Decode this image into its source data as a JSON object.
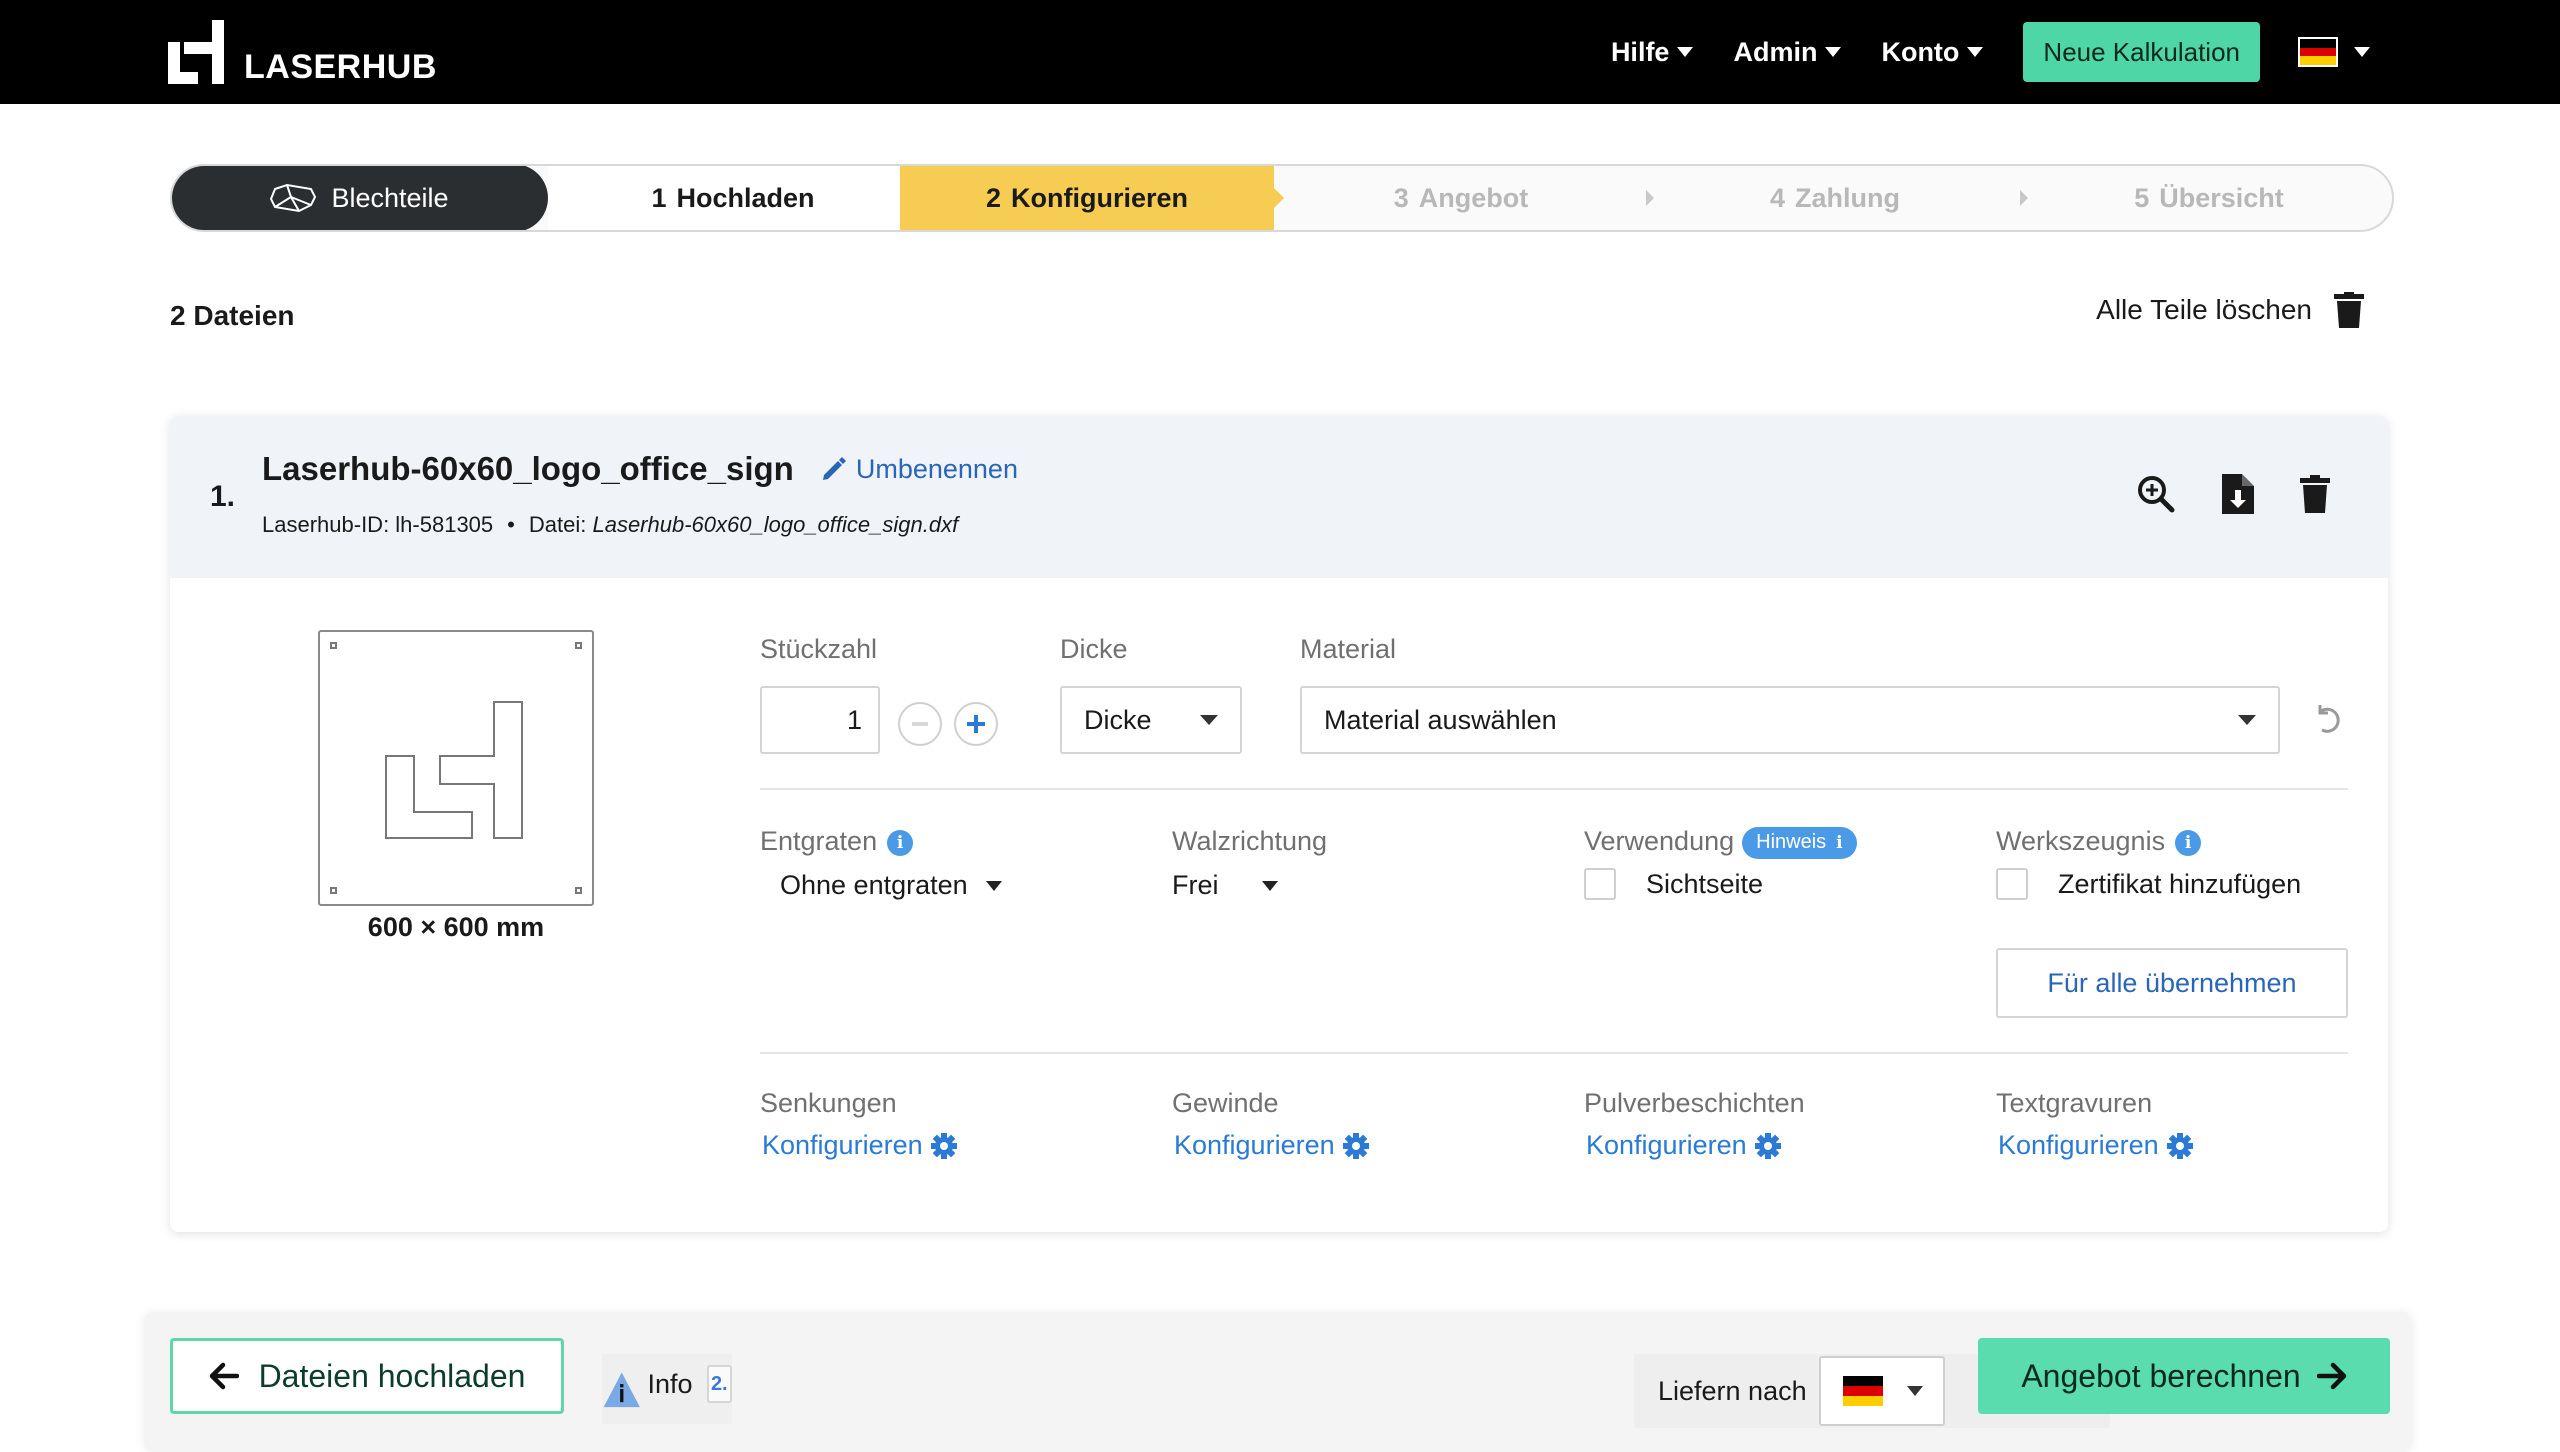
{
  "navbar": {
    "brand": "LASERHUB",
    "menu": [
      {
        "label": "Hilfe"
      },
      {
        "label": "Admin"
      },
      {
        "label": "Konto"
      }
    ],
    "new_calc_label": "Neue Kalkulation",
    "language_flag": "de-flag",
    "colors": {
      "background": "#000000",
      "accent": "#4fd6a6"
    }
  },
  "stepper": {
    "category_label": "Blechteile",
    "steps": [
      {
        "num": "1",
        "label": "Hochladen",
        "state": "done"
      },
      {
        "num": "2",
        "label": "Konfigurieren",
        "state": "active"
      },
      {
        "num": "3",
        "label": "Angebot",
        "state": "pending"
      },
      {
        "num": "4",
        "label": "Zahlung",
        "state": "pending"
      },
      {
        "num": "5",
        "label": "Übersicht",
        "state": "pending"
      }
    ],
    "active_color": "#f6cd52"
  },
  "files": {
    "count_label": "2 Dateien",
    "delete_all_label": "Alle Teile löschen"
  },
  "part": {
    "index": "1.",
    "name": "Laserhub-60x60_logo_office_sign",
    "rename_label": "Umbenennen",
    "id_label": "Laserhub-ID: lh-581305",
    "separator": "•",
    "file_prefix": "Datei:",
    "file_name": "Laserhub-60x60_logo_office_sign.dxf",
    "dimensions": "600 × 600 mm",
    "quantity": {
      "label": "Stückzahl",
      "value": "1"
    },
    "thickness": {
      "label": "Dicke",
      "value": "Dicke"
    },
    "material": {
      "label": "Material",
      "value": "Material auswählen"
    },
    "deburring": {
      "label": "Entgraten",
      "value": "Ohne entgraten"
    },
    "rolling_direction": {
      "label": "Walzrichtung",
      "value": "Frei"
    },
    "usage": {
      "label": "Verwendung",
      "badge": "Hinweis",
      "checkbox_label": "Sichtseite",
      "checked": false
    },
    "certificate": {
      "label": "Werkszeugnis",
      "checkbox_label": "Zertifikat hinzufügen",
      "checked": false
    },
    "apply_all_label": "Für alle übernehmen",
    "extras": [
      {
        "label": "Senkungen",
        "link": "Konfigurieren"
      },
      {
        "label": "Gewinde",
        "link": "Konfigurieren"
      },
      {
        "label": "Pulverbeschichten",
        "link": "Konfigurieren"
      },
      {
        "label": "Textgravuren",
        "link": "Konfigurieren"
      }
    ]
  },
  "footer": {
    "upload_label": "Dateien hochladen",
    "info_label": "Info",
    "info_count": "2.",
    "deliver_label": "Liefern nach",
    "deliver_country_flag": "de-flag",
    "calc_label": "Angebot berechnen",
    "accent": "#5adcae"
  }
}
